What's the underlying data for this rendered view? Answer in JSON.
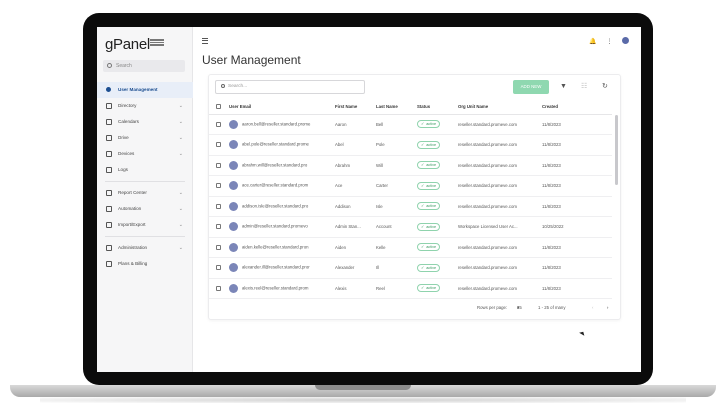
{
  "app": {
    "logo_text": "gPanel",
    "search_placeholder": "Search"
  },
  "sidebar": {
    "items": [
      {
        "label": "User Management",
        "icon": "person-icon",
        "active": true,
        "chevron": false
      },
      {
        "label": "Directory",
        "icon": "directory-icon",
        "chevron": true
      },
      {
        "label": "Calendars",
        "icon": "calendar-icon",
        "chevron": true
      },
      {
        "label": "Drive",
        "icon": "drive-icon",
        "chevron": true
      },
      {
        "label": "Devices",
        "icon": "devices-icon",
        "chevron": true
      },
      {
        "label": "Logs",
        "icon": "logs-icon",
        "chevron": false
      },
      {
        "label": "Report Center",
        "icon": "report-icon",
        "chevron": true
      },
      {
        "label": "Automation",
        "icon": "automation-icon",
        "chevron": true
      },
      {
        "label": "Import/Export",
        "icon": "import-export-icon",
        "chevron": true
      },
      {
        "label": "Administration",
        "icon": "admin-icon",
        "chevron": true
      },
      {
        "label": "Plans & Billing",
        "icon": "billing-icon",
        "chevron": false
      }
    ]
  },
  "header": {
    "title": "User Management"
  },
  "toolbar": {
    "search_placeholder": "Search...",
    "add_label": "ADD NEW"
  },
  "table": {
    "columns": [
      "User Email",
      "First Name",
      "Last Name",
      "Status",
      "Org Unit Name",
      "Created"
    ],
    "rows": [
      [
        "aaron.bell@reseller.standard.prome",
        "Aaron",
        "Bell",
        "active",
        "reseller.standard.promeve.com",
        "11/8/2023"
      ],
      [
        "abel.pole@reseller.standard.prome",
        "Abel",
        "Pole",
        "active",
        "reseller.standard.promeve.com",
        "11/8/2023"
      ],
      [
        "abrahm.will@reseller.standard.pro",
        "Abrahm",
        "Will",
        "active",
        "reseller.standard.promeve.com",
        "11/8/2023"
      ],
      [
        "ace.carter@reseller.standard.prom",
        "Ace",
        "Carter",
        "active",
        "reseller.standard.promeve.com",
        "11/8/2023"
      ],
      [
        "addison.isle@reseller.standard.pro",
        "Addison",
        "Isle",
        "active",
        "reseller.standard.promeve.com",
        "11/8/2023"
      ],
      [
        "admin@reseller.standard.promevo",
        "Admin Stan...",
        "Account",
        "active",
        "Workspace Licensed User Ac...",
        "10/25/2022"
      ],
      [
        "aiden.kelle@reseller.standard.pron",
        "Aiden",
        "Kelle",
        "active",
        "reseller.standard.promeve.com",
        "11/8/2023"
      ],
      [
        "alexander.ill@reseller.standard.pror",
        "Alexander",
        "Ill",
        "active",
        "reseller.standard.promeve.com",
        "11/8/2023"
      ],
      [
        "alexis.reel@reseller.standard.prom",
        "Alexis",
        "Reel",
        "active",
        "reseller.standard.promeve.com",
        "11/8/2023"
      ]
    ]
  },
  "pager": {
    "rows_label": "Rows per page:",
    "rows_value": "25",
    "range": "1 - 25 of many"
  }
}
